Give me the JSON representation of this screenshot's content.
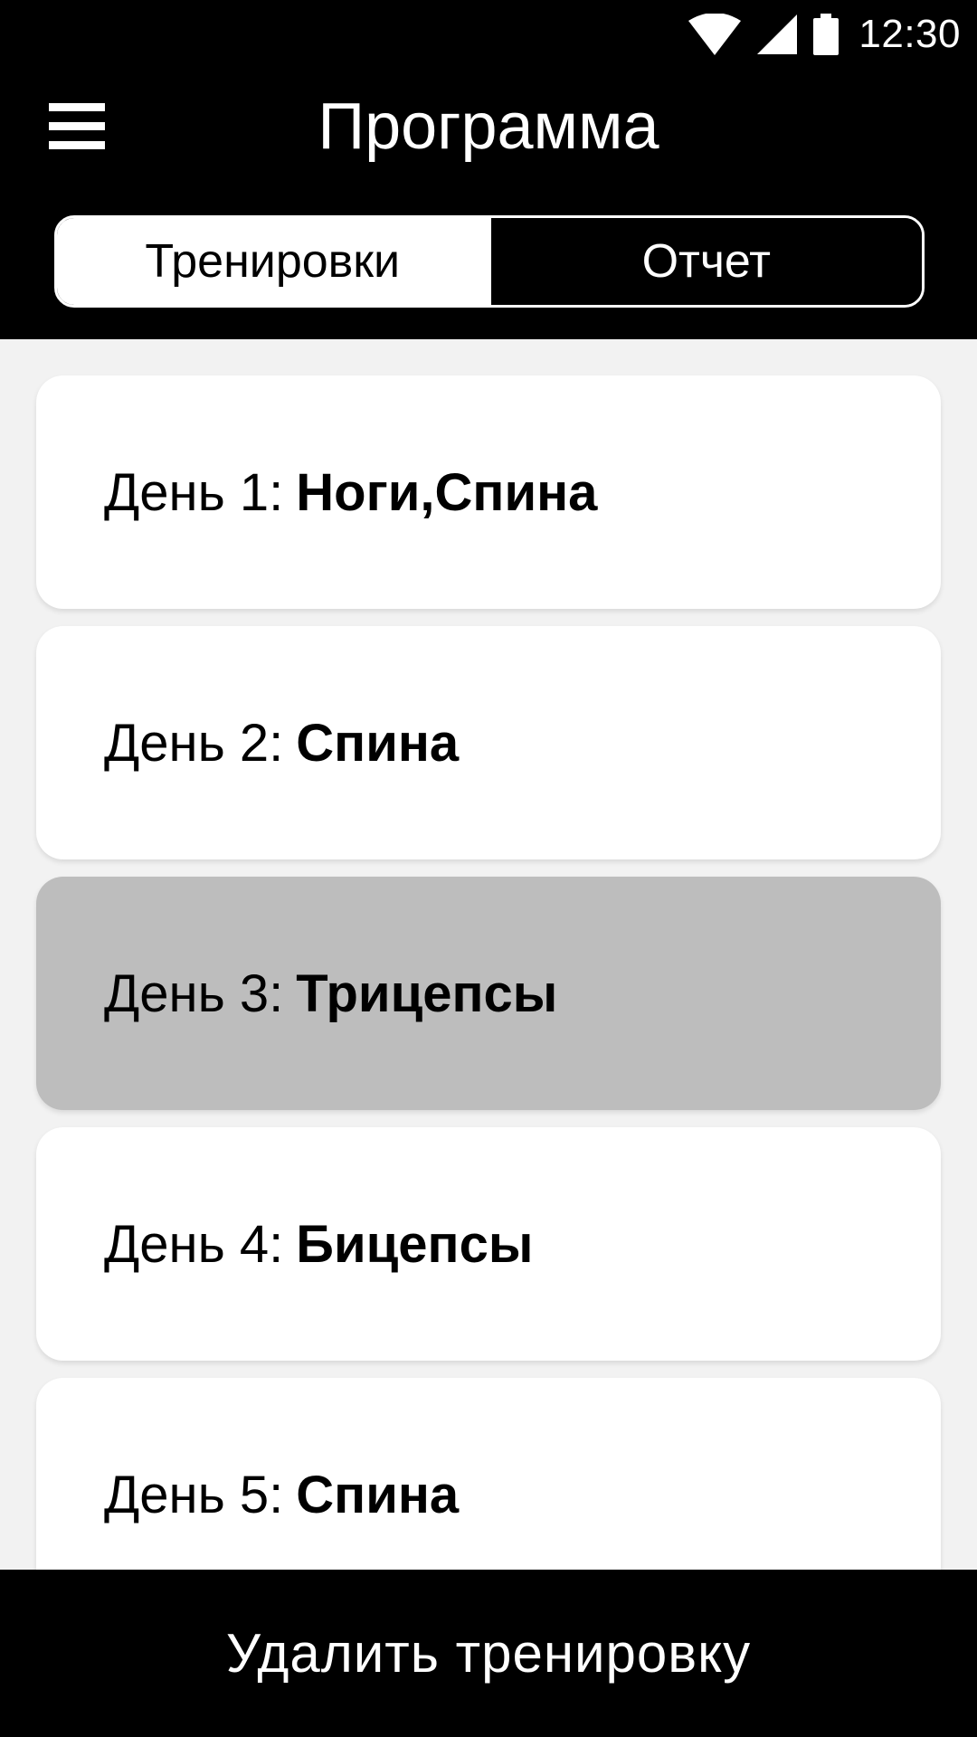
{
  "status_bar": {
    "time": "12:30",
    "icons": [
      "wifi-icon",
      "cellular-signal-icon",
      "battery-icon"
    ],
    "background_color": "#000000"
  },
  "app_bar": {
    "title": "Программа",
    "menu_icon": "menu-icon",
    "background_color": "#000000"
  },
  "tabs": [
    {
      "label": "Тренировки",
      "active": true
    },
    {
      "label": "Отчет",
      "active": false
    }
  ],
  "workouts": [
    {
      "day_label": "День 1:",
      "muscles": "Ноги,Спина",
      "selected": false
    },
    {
      "day_label": "День 2:",
      "muscles": "Спина",
      "selected": false
    },
    {
      "day_label": "День 3:",
      "muscles": "Трицепсы",
      "selected": true
    },
    {
      "day_label": "День 4:",
      "muscles": "Бицепсы",
      "selected": false
    },
    {
      "day_label": "День 5:",
      "muscles": "Спина",
      "selected": false
    }
  ],
  "actions": {
    "delete_label": "Удалить тренировку"
  },
  "colors": {
    "list_background": "#f2f2f2",
    "card_background": "#ffffff",
    "selected_card_background": "#bdbdbd",
    "accent": "#000000"
  }
}
